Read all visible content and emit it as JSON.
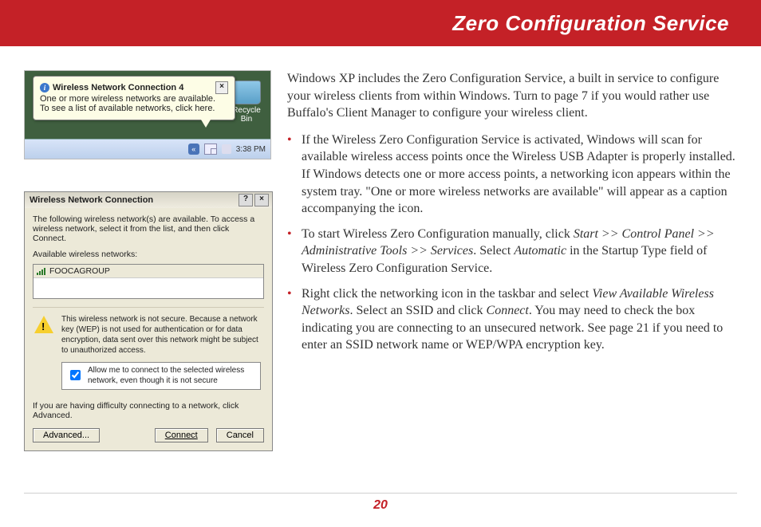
{
  "header": {
    "title": "Zero Configuration Service"
  },
  "footer": {
    "page_number": "20"
  },
  "body": {
    "intro": "Windows XP includes the Zero Configuration Service, a built in service to configure your wireless clients from within Windows.  Turn to page 7 if you would rather use Buffalo's Client Manager to configure your wireless client.",
    "bullets": {
      "b1": "If the Wireless Zero Configuration Service is activated, Windows will scan for available wireless access points once the Wireless USB Adapter is properly installed.  If Windows detects one or more access points, a networking icon appears within the system tray.  \"One or more wireless networks are available\" will appear as a caption accompanying the icon.",
      "b2_pre": "To start Wireless Zero Configuration manually, click ",
      "b2_path": "Start >> Control Panel >> Administrative Tools >> Services",
      "b2_mid": ". Select ",
      "b2_auto": "Automatic",
      "b2_post": " in the Startup Type field of Wireless Zero Configuration Service.",
      "b3_pre": "Right click the networking icon in the taskbar and select ",
      "b3_view": "View Available Wireless Networks",
      "b3_mid1": ".  Select an SSID and click ",
      "b3_connect": "Connect",
      "b3_post": ".  You may need to check the box indicating you are connecting to an unsecured network.  See page 21 if you need to enter an SSID network name or WEP/WPA encryption key."
    }
  },
  "shot1": {
    "recycle_label": "Recycle Bin",
    "balloon_title": "Wireless Network Connection 4",
    "balloon_line1": "One or more wireless networks are available.",
    "balloon_line2": "To see a list of available networks, click here.",
    "clock": "3:38 PM"
  },
  "shot2": {
    "title": "Wireless Network Connection",
    "intro": "The following wireless network(s) are available. To access a wireless network, select it from the list, and then click Connect.",
    "available_label": "Available wireless networks:",
    "ssid": "FOOCAGROUP",
    "warning": "This wireless network is not secure. Because a network key (WEP) is not used for authentication or for data encryption, data sent over this network might be subject to unauthorized access.",
    "allow_checkbox": "Allow me to connect to the selected wireless network, even though it is not secure",
    "difficulty": "If you are having difficulty connecting to a network, click Advanced.",
    "btn_advanced": "Advanced...",
    "btn_connect": "Connect",
    "btn_cancel": "Cancel"
  }
}
